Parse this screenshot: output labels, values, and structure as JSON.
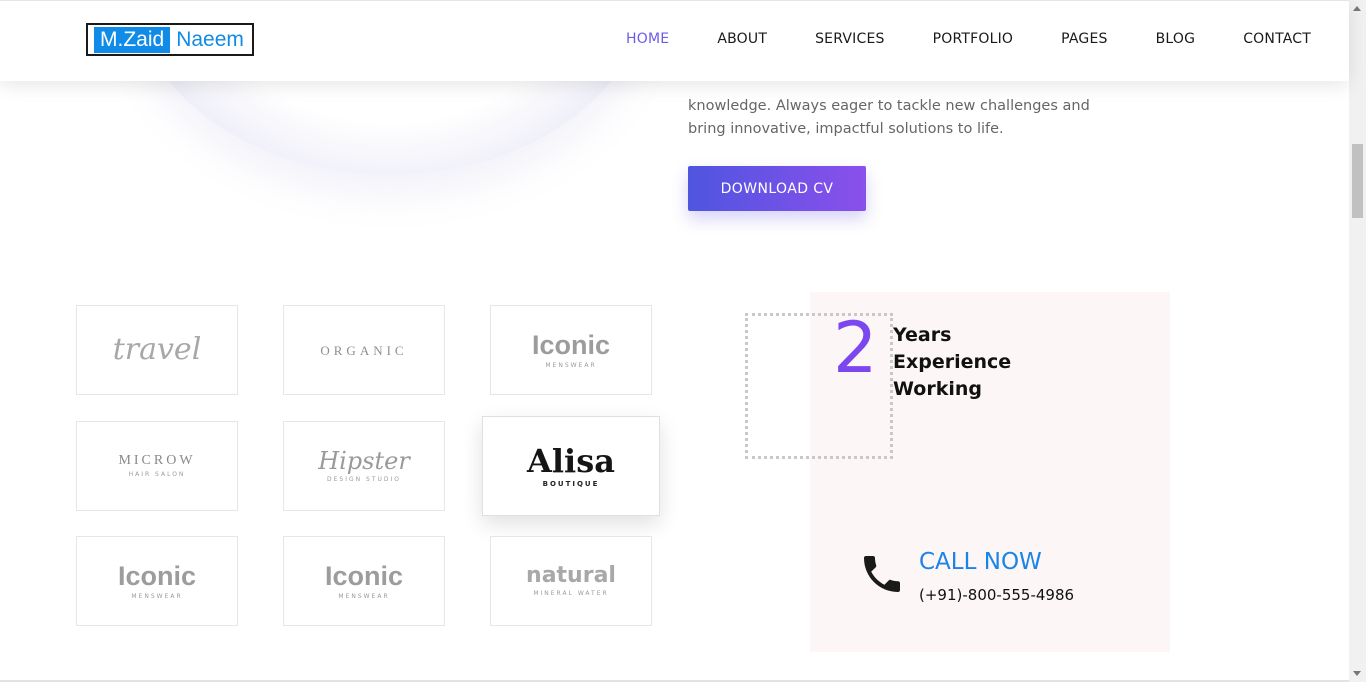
{
  "header": {
    "logo": {
      "first": "M.Zaid",
      "last": "Naeem"
    },
    "nav": [
      "HOME",
      "ABOUT",
      "SERVICES",
      "PORTFOLIO",
      "PAGES",
      "BLOG",
      "CONTACT"
    ],
    "active_nav": "HOME",
    "accent_color": "#6c5ce7"
  },
  "about": {
    "text": "knowledge. Always eager to tackle new challenges and bring innovative, impactful solutions to life.",
    "cv_button": "DOWNLOAD CV"
  },
  "brands": [
    {
      "main": "travel",
      "sub": ""
    },
    {
      "main": "ORGANIC",
      "sub": ""
    },
    {
      "main": "Iconic",
      "sub": "MENSWEAR"
    },
    {
      "main": "MICROW",
      "sub": "HAIR SALON"
    },
    {
      "main": "Hipster",
      "sub": "DESIGN STUDIO"
    },
    {
      "main": "Alisa",
      "sub": "BOUTIQUE"
    },
    {
      "main": "Iconic",
      "sub": "MENSWEAR"
    },
    {
      "main": "Iconic",
      "sub": "MENSWEAR"
    },
    {
      "main": "natural",
      "sub": "MINERAL WATER"
    }
  ],
  "experience": {
    "number": "2",
    "label_line1": "Years",
    "label_line2": "Experience",
    "label_line3": "Working",
    "number_color": "#7c47ee"
  },
  "call": {
    "title": "CALL NOW",
    "number": "(+91)-800-555-4986",
    "icon": "phone-icon",
    "title_color": "#1a84e8"
  }
}
